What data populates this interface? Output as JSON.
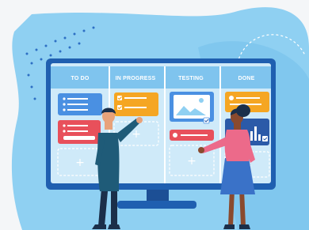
{
  "board": {
    "columns": [
      {
        "label": "TO DO"
      },
      {
        "label": "IN PROGRESS"
      },
      {
        "label": "TESTING"
      },
      {
        "label": "DONE"
      }
    ]
  },
  "colors": {
    "background_blob": "#8fd0f2",
    "monitor_frame": "#1f5fb0",
    "screen": "#cfeaf9",
    "header_bar": "#7fc4ee",
    "card_blue": "#4a90e2",
    "card_red": "#e8505b",
    "card_orange": "#f5a623",
    "card_navy": "#2b5aa8",
    "person_teal": "#1f5b78",
    "person_pink": "#ec6a8a",
    "person_skirt": "#3a72c8"
  },
  "icons": [
    "checkmark-icon",
    "image-icon",
    "plus-icon",
    "bar-chart-icon"
  ]
}
